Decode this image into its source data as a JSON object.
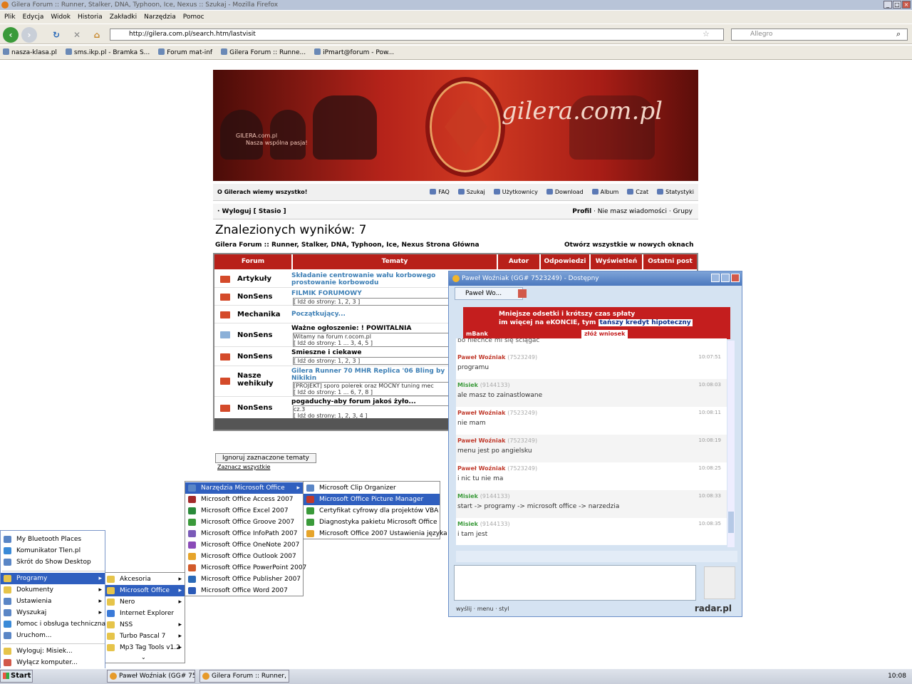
{
  "window": {
    "title": "Gilera Forum :: Runner, Stalker, DNA, Typhoon, Ice, Nexus :: Szukaj - Mozilla Firefox"
  },
  "menu": [
    "Plik",
    "Edycja",
    "Widok",
    "Historia",
    "Zakładki",
    "Narzędzia",
    "Pomoc"
  ],
  "nav": {
    "url": "http://gilera.com.pl/search.htm/lastvisit",
    "search_placeholder": "Allegro"
  },
  "bookmarks": [
    "nasza-klasa.pl",
    "sms.ikp.pl - Bramka S...",
    "Forum mat-inf",
    "Gilera Forum :: Runne...",
    "iPmart@forum - Pow..."
  ],
  "banner": {
    "brand": "gilera.com.pl",
    "tagline1": "GILERA.com.pl",
    "tagline2": "Nasza wspólna pasja!"
  },
  "site_nav": {
    "slogan": "O Gilerach wiemy wszystko!",
    "links": [
      "FAQ",
      "Szukaj",
      "Użytkownicy",
      "Download",
      "Album",
      "Czat",
      "Statystyki"
    ]
  },
  "user_row": {
    "left": "· Wyloguj [ Stasio ]",
    "right_bold": "Profil",
    "right_rest": "· Nie masz wiadomości · Grupy"
  },
  "results": {
    "heading": "Znalezionych wyników: 7",
    "breadcrumb": "Gilera Forum :: Runner, Stalker, DNA, Typhoon, Ice, Nexus Strona Główna",
    "open_all": "Otwórz wszystkie w nowych oknach",
    "columns": [
      "Forum",
      "Tematy",
      "Autor",
      "Odpowiedzi",
      "Wyświetleń",
      "Ostatni post"
    ],
    "rows": [
      {
        "forum": "Artykuły",
        "topic": "Składanie centrowanie wału korbowego prostowanie korbowodu",
        "sub": ""
      },
      {
        "forum": "NonSens",
        "topic": "FILMIK FORUMOWY",
        "sub": "[ Idź do strony: 1, 2, 3 ]"
      },
      {
        "forum": "Mechanika",
        "topic": "Początkujący...",
        "sub": ""
      },
      {
        "forum": "NonSens",
        "topic": "Ważne ogłoszenie: ! POWITALNIA",
        "sub": "Witamy na forum r.ocom.pl\n[ Idź do strony: 1 ... 3, 4, 5 ]"
      },
      {
        "forum": "NonSens",
        "topic": "Śmieszne i ciekawe",
        "sub": "[ Idź do strony: 1, 2, 3 ]"
      },
      {
        "forum": "Nasze wehikuły",
        "topic": "Gilera Runner 70 MHR Replica '06 Bling by Nikikin",
        "sub": "[PROJEKT] sporo polerek oraz MOCNY tuning mec\n[ Idź do strony: 1 ... 6, 7, 8 ]"
      },
      {
        "forum": "NonSens",
        "topic": "pogaduchy-aby forum jakoś żyło...",
        "sub": "cz.3\n[ Idź do strony: 1, 2, 3, 4 ]"
      }
    ],
    "ignore_button": "Ignoruj zaznaczone tematy",
    "mark_all": "Zaznacz wszystkie"
  },
  "chat": {
    "title": "Paweł Woźniak (GG# 7523249) - Dostępny",
    "tab": "Paweł Wo...",
    "ad_line1": "Mniejsze odsetki i krótszy czas spłaty",
    "ad_line2": "im więcej na eKONCIE, tym",
    "ad_highlight": "tańszy kredyt hipoteczny",
    "ad_button": "złóż wniosek",
    "ad_brand": "mBank",
    "cut_line": "bo niechce mi się ściągać",
    "messages": [
      {
        "name": "Paweł Woźniak",
        "uin": "(7523249)",
        "time": "10:07:51",
        "text": "programu",
        "color": "#c0392b"
      },
      {
        "name": "Misiek",
        "uin": "(9144133)",
        "time": "10:08:03",
        "text": "ale masz to zainastlowane",
        "color": "#3a9a3a"
      },
      {
        "name": "Paweł Woźniak",
        "uin": "(7523249)",
        "time": "10:08:11",
        "text": "nie mam",
        "color": "#c0392b"
      },
      {
        "name": "Paweł Woźniak",
        "uin": "(7523249)",
        "time": "10:08:19",
        "text": "menu jest po angielsku",
        "color": "#c0392b"
      },
      {
        "name": "Paweł Woźniak",
        "uin": "(7523249)",
        "time": "10:08:25",
        "text": "i nic tu nie ma",
        "color": "#c0392b"
      },
      {
        "name": "Misiek",
        "uin": "(9144133)",
        "time": "10:08:33",
        "text": "start -> programy -> microsoft office -> narzedzia",
        "color": "#3a9a3a"
      },
      {
        "name": "Misiek",
        "uin": "(9144133)",
        "time": "10:08:35",
        "text": "i tam jest",
        "color": "#3a9a3a"
      }
    ],
    "bottom": "wyślij · menu · styl",
    "brand": "radar.pl"
  },
  "start_menu": {
    "top_items": [
      "My Bluetooth Places",
      "Komunikator Tlen.pl",
      "Skrót do Show Desktop"
    ],
    "items": [
      "Programy",
      "Dokumenty",
      "Ustawienia",
      "Wyszukaj",
      "Pomoc i obsługa techniczna",
      "Uruchom..."
    ],
    "bottom_items": [
      "Wyloguj: Misiek...",
      "Wyłącz komputer..."
    ]
  },
  "programs_menu": [
    "Akcesoria",
    "Microsoft Office",
    "Nero",
    "Internet Explorer",
    "NSS",
    "Turbo Pascal 7",
    "Mp3 Tag Tools v1.2"
  ],
  "office_menu": [
    "Narzędzia Microsoft Office",
    "Microsoft Office Access 2007",
    "Microsoft Office Excel 2007",
    "Microsoft Office Groove 2007",
    "Microsoft Office InfoPath 2007",
    "Microsoft Office OneNote 2007",
    "Microsoft Office Outlook 2007",
    "Microsoft Office PowerPoint 2007",
    "Microsoft Office Publisher 2007",
    "Microsoft Office Word 2007"
  ],
  "tools_menu": [
    "Microsoft Clip Organizer",
    "Microsoft Office Picture Manager",
    "Certyfikat cyfrowy dla projektów VBA",
    "Diagnostyka pakietu Microsoft Office",
    "Microsoft Office 2007 Ustawienia języka"
  ],
  "taskbar": {
    "start": "Start",
    "tasks": [
      "Paweł Woźniak (GG# 75...",
      "Gilera Forum :: Runner, ..."
    ],
    "clock": "10:08"
  }
}
